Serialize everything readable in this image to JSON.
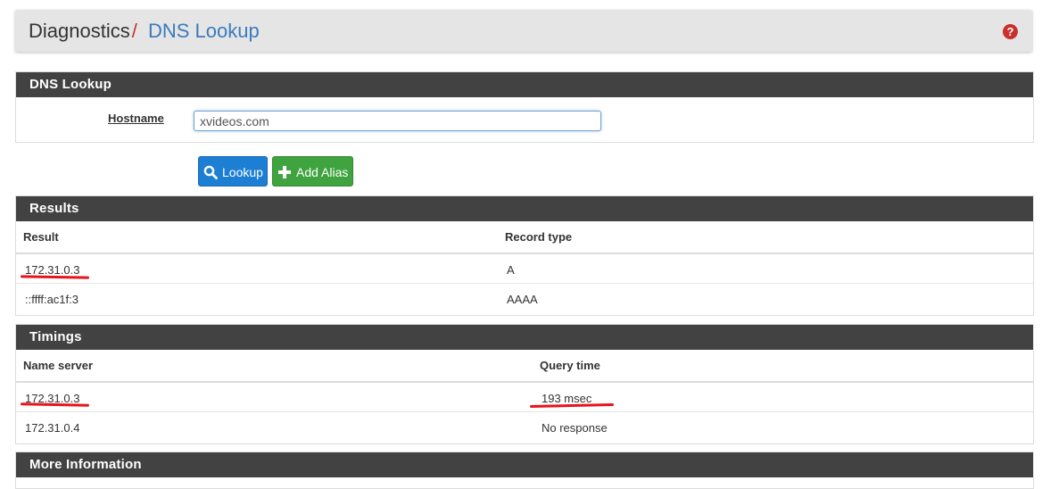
{
  "breadcrumb": {
    "parent": "Diagnostics",
    "separator": "/",
    "current": "DNS Lookup",
    "help_icon": "question-circle-icon",
    "help_glyph": "?"
  },
  "dns_lookup": {
    "title": "DNS Lookup",
    "hostname_label": "Hostname",
    "hostname_value": "xvideos.com"
  },
  "buttons": {
    "lookup": {
      "label": "Lookup",
      "icon": "search-icon",
      "color": "#1c7fd4"
    },
    "add_alias": {
      "label": "Add Alias",
      "icon": "plus-icon",
      "color": "#3fa33f"
    }
  },
  "results": {
    "title": "Results",
    "headers": [
      "Result",
      "Record type"
    ],
    "rows": [
      [
        "172.31.0.3",
        "A"
      ],
      [
        "::ffff:ac1f:3",
        "AAAA"
      ]
    ]
  },
  "timings": {
    "title": "Timings",
    "headers": [
      "Name server",
      "Query time"
    ],
    "rows": [
      [
        "172.31.0.3",
        "193 msec"
      ],
      [
        "172.31.0.4",
        "No response"
      ]
    ]
  },
  "more_information": {
    "title": "More Information"
  },
  "colors": {
    "panel_heading": "#424242",
    "link_blue": "#3a7bbf",
    "annotation_red": "#e8141b"
  }
}
